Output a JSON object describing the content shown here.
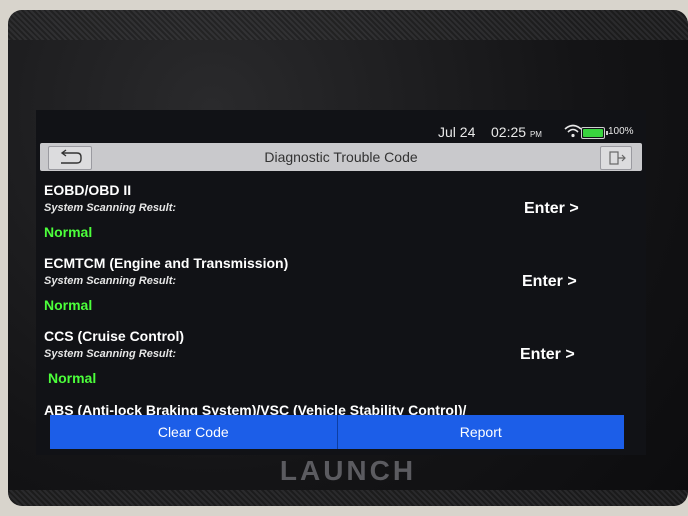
{
  "status": {
    "date": "Jul 24",
    "time": "02:25",
    "ampm": "PM",
    "battery": "100%"
  },
  "header": {
    "title": "Diagnostic Trouble Code"
  },
  "items": [
    {
      "name": "EOBD/OBD II",
      "sub": "System Scanning Result:",
      "status": "Normal",
      "action": "Enter >"
    },
    {
      "name": "ECMTCM (Engine and Transmission)",
      "sub": "System Scanning Result:",
      "status": "Normal",
      "action": "Enter >"
    },
    {
      "name": "CCS (Cruise Control)",
      "sub": "System Scanning Result:",
      "status": "Normal",
      "action": "Enter >"
    },
    {
      "name": "ABS (Anti-lock Braking System)/VSC (Vehicle Stability Control)/"
    }
  ],
  "footer": {
    "clear": "Clear Code",
    "report": "Report"
  },
  "brand": {
    "logo": "LAUNCH"
  },
  "colors": {
    "accent": "#1c5ee8",
    "normal": "#4cff3b",
    "battery": "#39d43e"
  }
}
